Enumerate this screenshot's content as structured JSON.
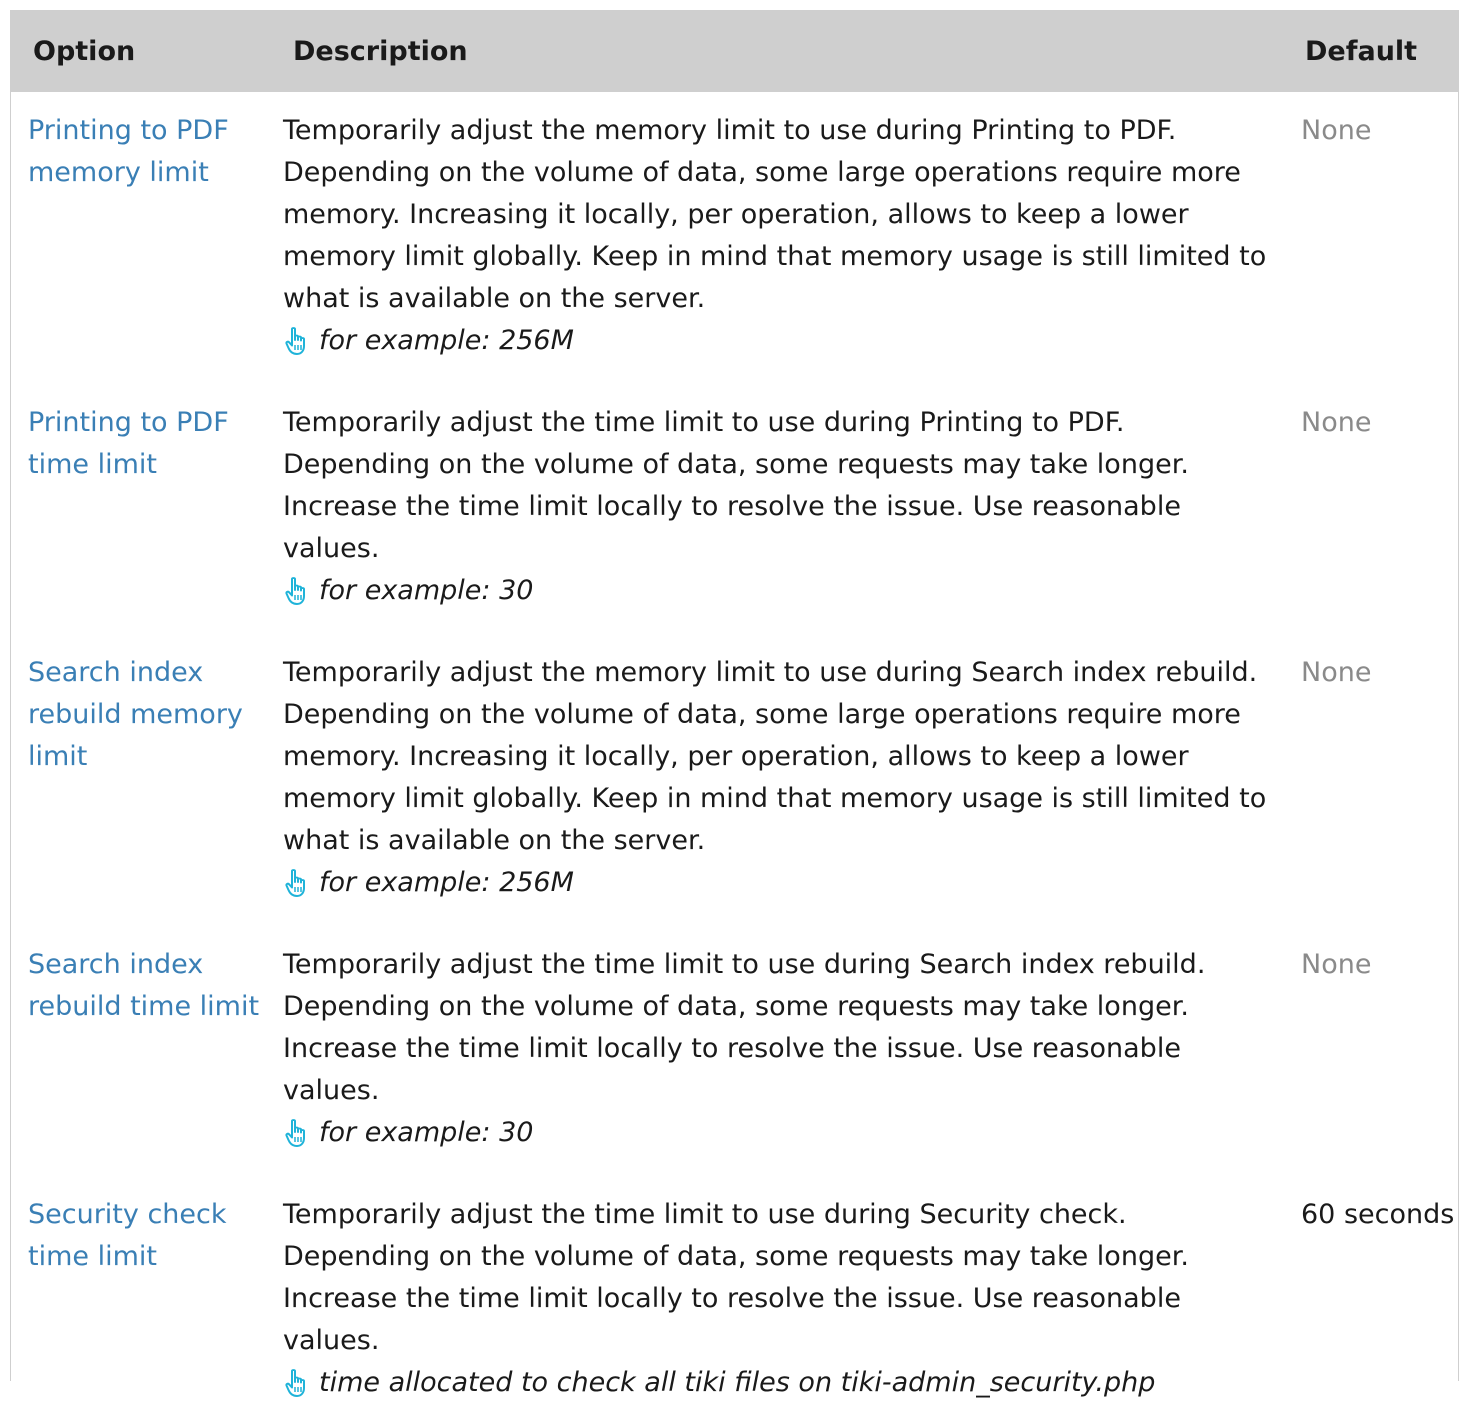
{
  "header": {
    "option": "Option",
    "description": "Description",
    "default": "Default"
  },
  "rows": [
    {
      "option": "Printing to PDF memory limit",
      "description": "Temporarily adjust the memory limit to use during Printing to PDF. Depending on the volume of data, some large operations require more memory. Increasing it locally, per operation, allows to keep a lower memory limit globally. Keep in mind that memory usage is still limited to what is available on the server.",
      "hint": "for example: 256M",
      "default": "None"
    },
    {
      "option": "Printing to PDF time limit",
      "description": "Temporarily adjust the time limit to use during Printing to PDF. Depending on the volume of data, some requests may take longer. Increase the time limit locally to resolve the issue. Use reasonable values.",
      "hint": "for example: 30",
      "default": "None"
    },
    {
      "option": "Search index rebuild memory limit",
      "description": "Temporarily adjust the memory limit to use during Search index rebuild. Depending on the volume of data, some large operations require more memory. Increasing it locally, per operation, allows to keep a lower memory limit globally. Keep in mind that memory usage is still limited to what is available on the server.",
      "hint": "for example: 256M",
      "default": "None"
    },
    {
      "option": "Search index rebuild time limit",
      "description": "Temporarily adjust the time limit to use during Search index rebuild. Depending on the volume of data, some requests may take longer. Increase the time limit locally to resolve the issue. Use reasonable values.",
      "hint": "for example: 30",
      "default": "None"
    },
    {
      "option": "Security check time limit",
      "description": "Temporarily adjust the time limit to use during Security check. Depending on the volume of data, some requests may take longer. Increase the time limit locally to resolve the issue. Use reasonable values.",
      "hint": "time allocated to check all tiki files on tiki-admin_security.php",
      "default": "60 seconds"
    }
  ],
  "colors": {
    "link": "#3a7fb5",
    "header_bg": "#cfcfcf",
    "muted": "#8a8a8a",
    "hint_icon": "#1fb3d9"
  },
  "icons": {
    "hint": "pointing-hand-icon"
  }
}
